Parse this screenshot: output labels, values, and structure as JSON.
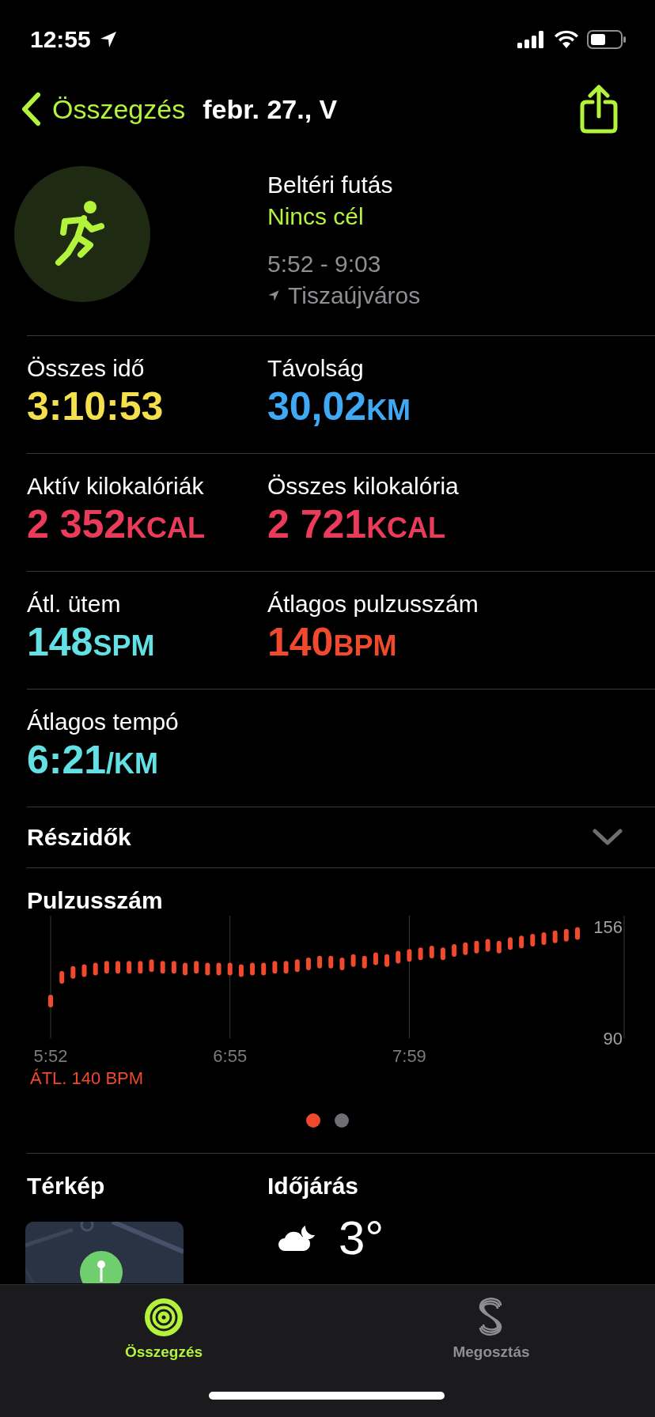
{
  "status_bar": {
    "time": "12:55"
  },
  "nav": {
    "back_label": "Összegzés",
    "title": "febr. 27., V"
  },
  "workout": {
    "type": "Beltéri futás",
    "goal": "Nincs cél",
    "time_range": "5:52 - 9:03",
    "location": "Tiszaújváros"
  },
  "metrics": [
    [
      {
        "label": "Összes idő",
        "value": "3:10:53",
        "color": "#f4e04d"
      },
      {
        "label": "Távolság",
        "value": "30,02",
        "unit": "KM",
        "color": "#3fa9f5"
      }
    ],
    [
      {
        "label": "Aktív kilokalóriák",
        "value": "2 352",
        "unit": "KCAL",
        "color": "#ea3b5b"
      },
      {
        "label": "Összes kilokalória",
        "value": "2 721",
        "unit": "KCAL",
        "color": "#ea3b5b"
      }
    ],
    [
      {
        "label": "Átl. ütem",
        "value": "148",
        "unit": "SPM",
        "color": "#63e0e3"
      },
      {
        "label": "Átlagos pulzusszám",
        "value": "140",
        "unit": "BPM",
        "color": "#f0492d"
      }
    ],
    [
      {
        "label": "Átlagos tempó",
        "value": "6:21",
        "unit": "/KM",
        "color": "#63e0e3"
      }
    ]
  ],
  "splits": {
    "label": "Részidők",
    "expanded": false
  },
  "heart_rate": {
    "average_label": "ÁTL. 140 BPM",
    "chart_data": {
      "type": "scatter",
      "title": "Pulzusszám",
      "categories": [
        "5:52",
        null,
        null,
        null,
        null,
        null,
        null,
        null,
        null,
        null,
        null,
        null,
        null,
        null,
        null,
        null,
        "6:55",
        null,
        null,
        null,
        null,
        null,
        null,
        null,
        null,
        null,
        null,
        null,
        null,
        null,
        null,
        null,
        "7:59",
        null,
        null,
        null,
        null,
        null,
        null,
        null,
        null,
        null,
        null,
        null,
        null,
        null,
        null,
        null
      ],
      "series": [
        {
          "color": "#f0492d",
          "values": [
            112,
            126,
            129,
            130,
            131,
            132,
            132,
            132,
            132,
            133,
            132,
            132,
            131,
            132,
            131,
            131,
            131,
            130,
            131,
            131,
            132,
            132,
            133,
            134,
            135,
            135,
            134,
            136,
            135,
            137,
            136,
            138,
            139,
            140,
            141,
            140,
            142,
            143,
            144,
            145,
            144,
            146,
            147,
            148,
            149,
            150,
            151,
            152
          ]
        }
      ],
      "ylim": [
        90,
        156
      ],
      "yticks": [
        90,
        156
      ],
      "grid": true
    },
    "pages": [
      {
        "selected": true
      },
      {
        "selected": false
      }
    ]
  },
  "map": {
    "title": "Térkép"
  },
  "weather": {
    "title": "Időjárás",
    "temperature": "3°"
  },
  "tabs": [
    {
      "label": "Összegzés",
      "kind": "rings",
      "selected": true
    },
    {
      "label": "Megosztás",
      "kind": "sharing",
      "selected": false
    }
  ]
}
